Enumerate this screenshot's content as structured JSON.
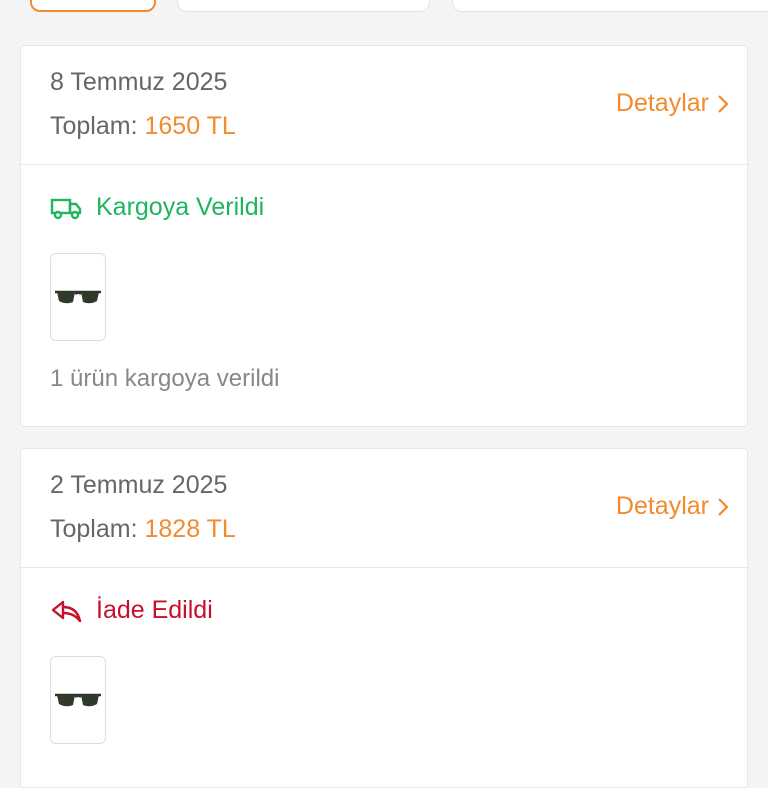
{
  "orders": [
    {
      "date": "8 Temmuz 2025",
      "total_label": "Toplam:",
      "total_amount": "1650 TL",
      "details_label": "Detaylar",
      "status": "Kargoya Verildi",
      "note": "1 ürün kargoya verildi"
    },
    {
      "date": "2 Temmuz 2025",
      "total_label": "Toplam:",
      "total_amount": "1828 TL",
      "details_label": "Detaylar",
      "status": "İade Edildi"
    }
  ],
  "colors": {
    "accent": "#f28a2e",
    "shipped": "#1fb55f",
    "returned": "#c8102e"
  },
  "icons": {
    "shipped": "truck-icon",
    "returned": "return-arrow-icon",
    "details": "chevron-right-icon",
    "product": "sunglasses-thumbnail"
  }
}
